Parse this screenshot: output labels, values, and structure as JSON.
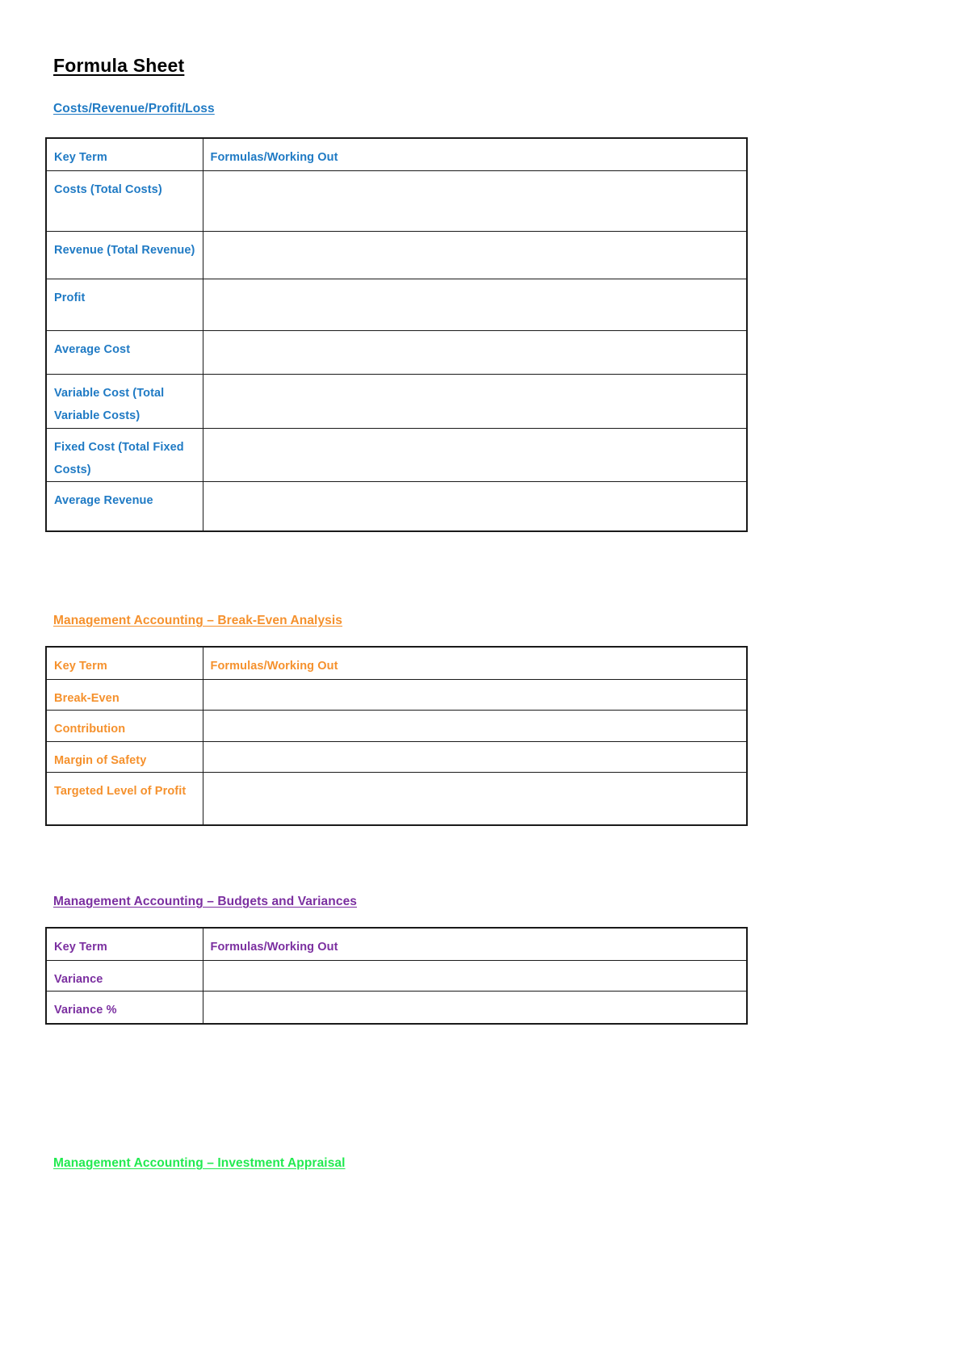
{
  "document": {
    "title": "Formula Sheet"
  },
  "sections": [
    {
      "id": "costs-revenue-profit-loss",
      "heading": "Costs/Revenue/Profit/Loss",
      "color": "#1f7ac4",
      "columns": [
        "Key Term",
        "Formulas/Working Out"
      ],
      "rows": [
        {
          "key_term": "Costs (Total Costs)",
          "formula": ""
        },
        {
          "key_term": "Revenue (Total Revenue)",
          "formula": ""
        },
        {
          "key_term": "Profit",
          "formula": ""
        },
        {
          "key_term": "Average Cost",
          "formula": ""
        },
        {
          "key_term": "Variable Cost (Total Variable Costs)",
          "formula": ""
        },
        {
          "key_term": "Fixed Cost (Total Fixed Costs)",
          "formula": ""
        },
        {
          "key_term": "Average Revenue",
          "formula": ""
        }
      ]
    },
    {
      "id": "break-even-analysis",
      "heading": "Management Accounting – Break-Even Analysis",
      "color": "#f5912d",
      "columns": [
        "Key Term",
        "Formulas/Working Out"
      ],
      "rows": [
        {
          "key_term": "Break-Even",
          "formula": ""
        },
        {
          "key_term": "Contribution",
          "formula": ""
        },
        {
          "key_term": "Margin of Safety",
          "formula": ""
        },
        {
          "key_term": "Targeted Level of Profit",
          "formula": ""
        }
      ]
    },
    {
      "id": "budgets-and-variances",
      "heading": "Management Accounting – Budgets and Variances",
      "color": "#7b2fa0",
      "columns": [
        "Key Term",
        "Formulas/Working Out"
      ],
      "rows": [
        {
          "key_term": "Variance",
          "formula": ""
        },
        {
          "key_term": "Variance %",
          "formula": ""
        }
      ]
    },
    {
      "id": "investment-appraisal",
      "heading": "Management Accounting – Investment Appraisal",
      "color": "#22ea50",
      "columns": [],
      "rows": []
    }
  ]
}
